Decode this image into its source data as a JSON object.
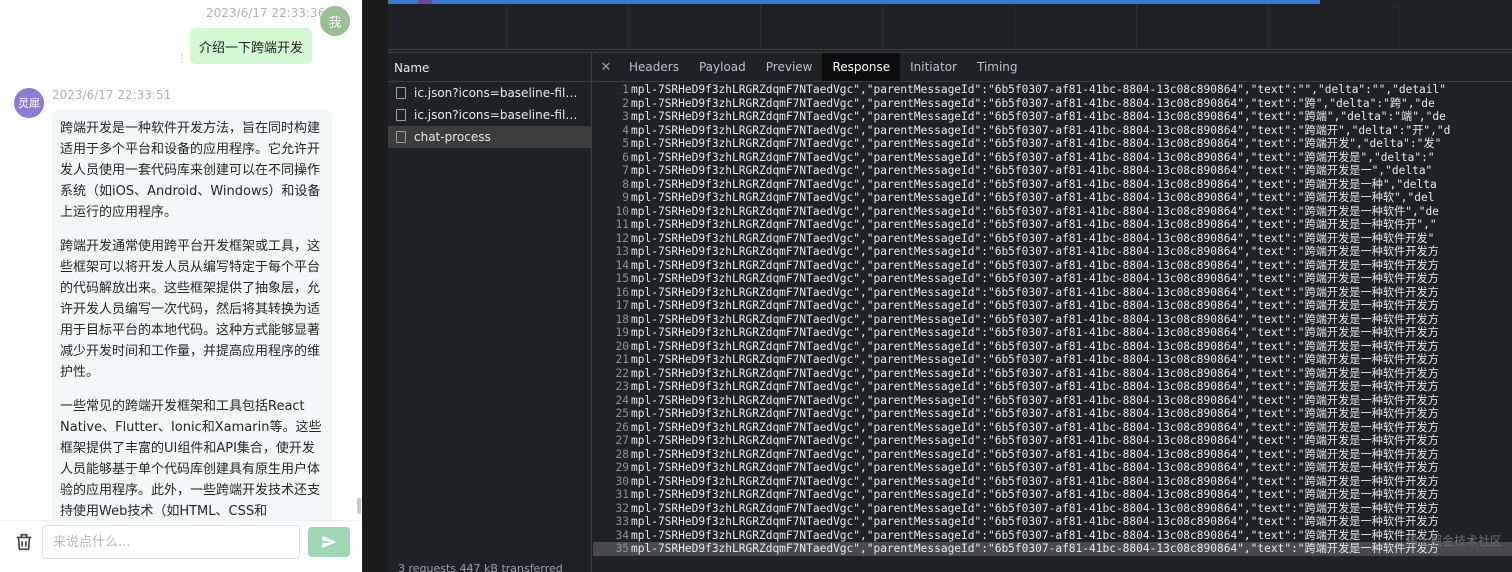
{
  "chat": {
    "user_message": {
      "time": "2023/6/17 22:33:36",
      "avatar": "我",
      "text": "介绍一下跨端开发"
    },
    "bot_message": {
      "avatar": "灵犀",
      "time": "2023/6/17 22:33:51",
      "paragraphs": [
        "跨端开发是一种软件开发方法，旨在同时构建适用于多个平台和设备的应用程序。它允许开发人员使用一套代码库来创建可以在不同操作系统（如iOS、Android、Windows）和设备上运行的应用程序。",
        "跨端开发通常使用跨平台开发框架或工具，这些框架可以将开发人员从编写特定于每个平台的代码解放出来。这些框架提供了抽象层，允许开发人员编写一次代码，然后将其转换为适用于目标平台的本地代码。这种方式能够显著减少开发时间和工作量，并提高应用程序的维护性。",
        "一些常见的跨端开发框架和工具包括React Native、Flutter、Ionic和Xamarin等。这些框架提供了丰富的UI组件和API集合，使开发人员能够基于单个代码库创建具有原生用户体验的应用程序。此外，一些跨端开发技术还支持使用Web技术（如HTML、CSS和JavaScript）进行开发，进一步简化了开发流"
      ]
    },
    "input_placeholder": "来说点什么..."
  },
  "devtools": {
    "name_header": "Name",
    "requests": [
      {
        "label": "ic.json?icons=baseline-file-d...",
        "selected": false
      },
      {
        "label": "ic.json?icons=baseline-file-d...",
        "selected": false
      },
      {
        "label": "chat-process",
        "selected": true
      }
    ],
    "status_text": "3 requests   447 kB transferred",
    "tabs": [
      "Headers",
      "Payload",
      "Preview",
      "Response",
      "Initiator",
      "Timing"
    ],
    "active_tab": "Response",
    "code_prefix": "mpl-7SRHeD9f3zhLRGRZdqmF7NTaedVgc\",\"parentMessageId\":\"6b5f0307-af81-41bc-8804-13c08c890864\",\"text\":\"",
    "lines": [
      {
        "n": 1,
        "tail": "\",\"delta\":\"\",\"detail\""
      },
      {
        "n": 2,
        "tail": "跨\",\"delta\":\"跨\",\"de"
      },
      {
        "n": 3,
        "tail": "跨端\",\"delta\":\"端\",\"de"
      },
      {
        "n": 4,
        "tail": "跨端开\",\"delta\":\"开\",\"d"
      },
      {
        "n": 5,
        "tail": "跨端开发\",\"delta\":\"发\""
      },
      {
        "n": 6,
        "tail": "跨端开发是\",\"delta\":\""
      },
      {
        "n": 7,
        "tail": "跨端开发是一\",\"delta\""
      },
      {
        "n": 8,
        "tail": "跨端开发是一种\",\"delta"
      },
      {
        "n": 9,
        "tail": "跨端开发是一种软\",\"del"
      },
      {
        "n": 10,
        "tail": "跨端开发是一种软件\",\"de"
      },
      {
        "n": 11,
        "tail": "跨端开发是一种软件开\",\""
      },
      {
        "n": 12,
        "tail": "跨端开发是一种软件开发\""
      },
      {
        "n": 13,
        "tail": "跨端开发是一种软件开发方"
      },
      {
        "n": 14,
        "tail": "跨端开发是一种软件开发方"
      },
      {
        "n": 15,
        "tail": "跨端开发是一种软件开发方"
      },
      {
        "n": 16,
        "tail": "跨端开发是一种软件开发方"
      },
      {
        "n": 17,
        "tail": "跨端开发是一种软件开发方"
      },
      {
        "n": 18,
        "tail": "跨端开发是一种软件开发方"
      },
      {
        "n": 19,
        "tail": "跨端开发是一种软件开发方"
      },
      {
        "n": 20,
        "tail": "跨端开发是一种软件开发方"
      },
      {
        "n": 21,
        "tail": "跨端开发是一种软件开发方"
      },
      {
        "n": 22,
        "tail": "跨端开发是一种软件开发方"
      },
      {
        "n": 23,
        "tail": "跨端开发是一种软件开发方"
      },
      {
        "n": 24,
        "tail": "跨端开发是一种软件开发方"
      },
      {
        "n": 25,
        "tail": "跨端开发是一种软件开发方"
      },
      {
        "n": 26,
        "tail": "跨端开发是一种软件开发方"
      },
      {
        "n": 27,
        "tail": "跨端开发是一种软件开发方"
      },
      {
        "n": 28,
        "tail": "跨端开发是一种软件开发方"
      },
      {
        "n": 29,
        "tail": "跨端开发是一种软件开发方"
      },
      {
        "n": 30,
        "tail": "跨端开发是一种软件开发方"
      },
      {
        "n": 31,
        "tail": "跨端开发是一种软件开发方"
      },
      {
        "n": 32,
        "tail": "跨端开发是一种软件开发方"
      },
      {
        "n": 33,
        "tail": "跨端开发是一种软件开发方"
      },
      {
        "n": 34,
        "tail": "跨端开发是一种软件开发方"
      },
      {
        "n": 35,
        "tail": "跨端开发是一种软件开发方"
      }
    ],
    "highlight_line": 35,
    "watermark": "稀土掘金技术社区"
  }
}
